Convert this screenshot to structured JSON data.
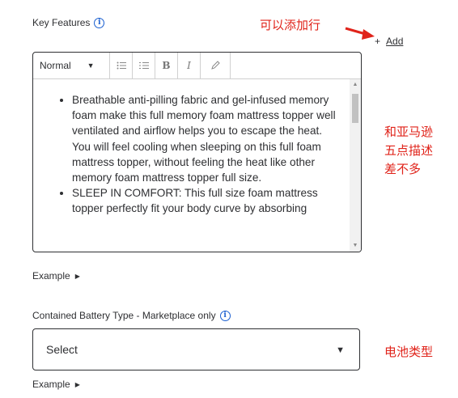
{
  "key_features": {
    "label": "Key Features",
    "info_icon": "i",
    "add_symbol": "+",
    "add_label": "Add"
  },
  "annotations": {
    "add_row": "可以添加行",
    "five_points_line1": "和亚马逊",
    "five_points_line2": "五点描述",
    "five_points_line3": "差不多",
    "battery_type": "电池类型",
    "color": "#e0231a"
  },
  "editor": {
    "format_select": "Normal",
    "toolbar_buttons": [
      "bullet-list",
      "numbered-list",
      "bold",
      "italic",
      "clear-format"
    ],
    "bold_glyph": "B",
    "italic_glyph": "I",
    "bullets": [
      "Breathable anti-pilling fabric and gel-infused memory foam make this full memory foam mattress topper well ventilated and airflow helps you to escape the heat. You will feel cooling when sleeping on this full foam mattress topper, without feeling the heat like other memory foam mattress topper full size.",
      "SLEEP IN COMFORT: This full size foam mattress topper perfectly fit your body curve by absorbing"
    ]
  },
  "example_links": {
    "first": "Example",
    "second": "Example"
  },
  "battery": {
    "label": "Contained Battery Type - Marketplace only",
    "info_icon": "i",
    "select_value": "Select"
  },
  "colors": {
    "link_blue": "#1a5fd0",
    "text": "#2e2f32",
    "border": "#2e2f32"
  }
}
